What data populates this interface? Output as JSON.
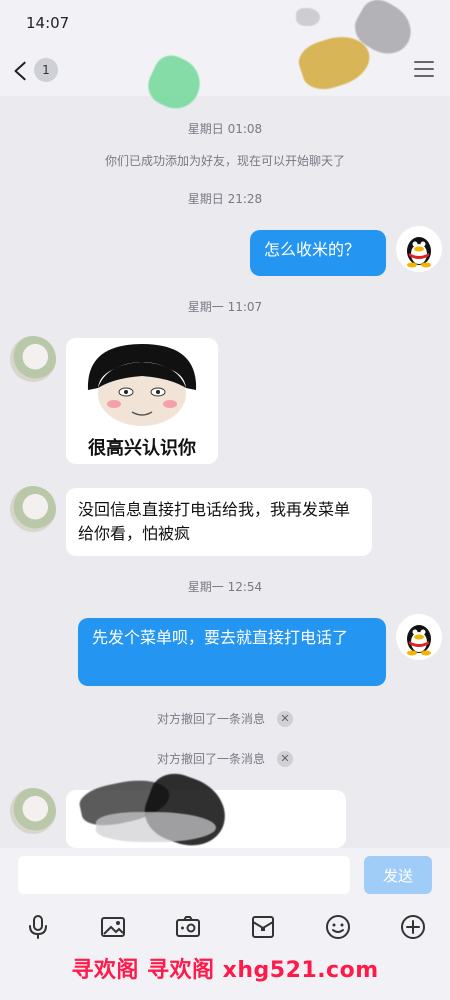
{
  "status": {
    "time": "14:07"
  },
  "header": {
    "unread_count": "1"
  },
  "messages": {
    "time1": "星期日 01:08",
    "friend_added": "你们已成功添加为好友，现在可以开始聊天了",
    "time2": "星期日 21:28",
    "me1": "怎么收米的？",
    "time3": "星期一 11:07",
    "sticker_caption": "很高兴认识你",
    "friend1": "没回信息直接打电话给我，我再发菜单给你看，怕被疯",
    "time4": "星期一 12:54",
    "me2": "先发个菜单呗，要去就直接打电话了",
    "recall1": "对方撤回了一条消息",
    "recall2": "对方撤回了一条消息"
  },
  "input": {
    "placeholder": "",
    "send_label": "发送"
  },
  "toolbar": {
    "icons": [
      "microphone-icon",
      "image-icon",
      "camera-icon",
      "red-packet-icon",
      "emoji-icon",
      "plus-icon"
    ]
  },
  "watermark": {
    "text": "寻欢阁 寻欢阁 xhg521.com"
  },
  "colors": {
    "accent": "#2496f2",
    "background": "#eaeaef",
    "watermark": "#ff1a4a"
  }
}
